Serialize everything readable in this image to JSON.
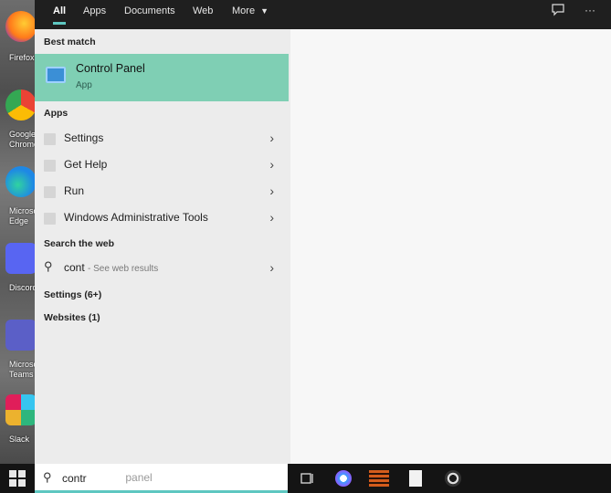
{
  "top_tabs": [
    {
      "label": "All",
      "active": true
    },
    {
      "label": "Apps",
      "active": false
    },
    {
      "label": "Documents",
      "active": false
    },
    {
      "label": "Web",
      "active": false
    },
    {
      "label": "More",
      "active": false
    }
  ],
  "top_icons": [
    "feedback-icon",
    "more-options-icon"
  ],
  "sections": {
    "best_match": "Best match",
    "apps": "Apps",
    "search_the_web": "Search the web",
    "settings": "Settings (6+)",
    "websites": "Websites (1)"
  },
  "best_match": {
    "title": "Control Panel",
    "subtitle": "App",
    "icon": "control-panel-icon"
  },
  "apps": [
    {
      "label": "Settings"
    },
    {
      "label": "Get Help"
    },
    {
      "label": "Run"
    },
    {
      "label": "Windows Administrative Tools"
    }
  ],
  "web_result": {
    "query": "cont",
    "suffix": "See web results"
  },
  "search": {
    "value": "contr",
    "placeholder": "control panel"
  },
  "desktop_icons": [
    {
      "name": "firefox-icon",
      "label": "Firefox",
      "color": "#ff7a1a"
    },
    {
      "name": "google-chrome-icon",
      "label": "Google Chrome",
      "color": "#4caf50"
    },
    {
      "name": "microsoft-edge-icon",
      "label": "Microsoft Edge",
      "color": "#1e88e5"
    },
    {
      "name": "discord-icon",
      "label": "Discord",
      "color": "#5865f2"
    },
    {
      "name": "microsoft-teams-icon",
      "label": "Microsoft Teams",
      "color": "#5b5fc7"
    },
    {
      "name": "slack-icon",
      "label": "Slack",
      "color": "#e8e8e8"
    }
  ],
  "taskbar_icons": [
    "task-view-icon",
    "itunes-icon",
    "media-app-icon",
    "file-icon",
    "obs-icon"
  ],
  "colors": {
    "accent": "#5ec7c1",
    "best_match_bg": "#7fcfb4"
  }
}
